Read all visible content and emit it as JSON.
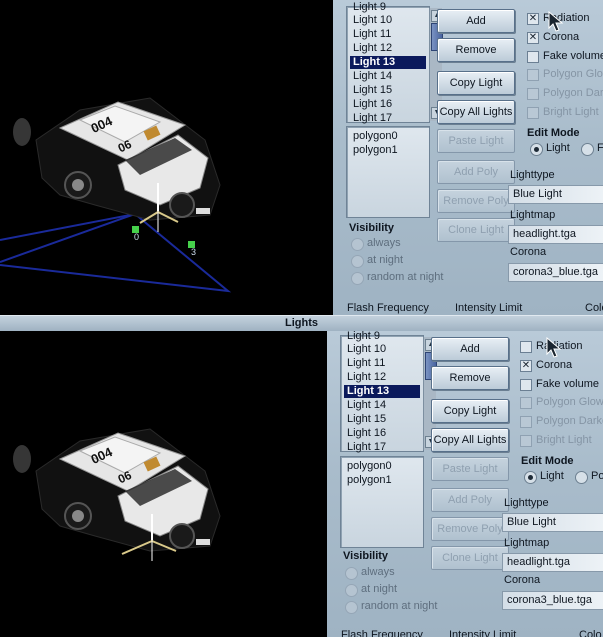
{
  "window_title": "Lights",
  "panels": [
    {
      "lights_list": [
        "Light 9",
        "Light 10",
        "Light 11",
        "Light 12",
        "Light 13",
        "Light 14",
        "Light 15",
        "Light 16",
        "Light 17"
      ],
      "selected_light": "Light 13",
      "polygons": [
        "polygon0",
        "polygon1"
      ],
      "buttons": {
        "add": "Add",
        "remove": "Remove",
        "copy_light": "Copy Light",
        "copy_all_lights": "Copy All Lights",
        "paste_light": "Paste Light",
        "add_poly": "Add Poly",
        "remove_poly": "Remove Poly",
        "clone_light": "Clone Light"
      },
      "options": {
        "radiation": {
          "label": "Radiation",
          "checked": true
        },
        "corona": {
          "label": "Corona",
          "checked": true
        },
        "fake_volume": {
          "label": "Fake volume",
          "checked": false
        },
        "polygon_glow": {
          "label": "Polygon Glow",
          "checked": false
        },
        "polygon_dark": {
          "label": "Polygon Dark",
          "checked": false
        },
        "bright_light": {
          "label": "Bright Light",
          "checked": false
        }
      },
      "edit_mode": {
        "title": "Edit Mode",
        "light": "Light",
        "other": "F"
      },
      "lighttype": {
        "label": "Lighttype",
        "value": "Blue Light"
      },
      "lightmap": {
        "label": "Lightmap",
        "value": "headlight.tga"
      },
      "corona_field": {
        "label": "Corona",
        "value": "corona3_blue.tga"
      },
      "visibility": {
        "title": "Visibility",
        "always": "always",
        "at_night": "at night",
        "random": "random at night",
        "selected": "at night"
      },
      "footer": {
        "flash_frequency": "Flash Frequency",
        "intensity_limit": "Intensity Limit",
        "color": "Colo"
      },
      "gizmo_points": [
        "0",
        "3"
      ]
    },
    {
      "lights_list": [
        "Light 9",
        "Light 10",
        "Light 11",
        "Light 12",
        "Light 13",
        "Light 14",
        "Light 15",
        "Light 16",
        "Light 17"
      ],
      "selected_light": "Light 13",
      "polygons": [
        "polygon0",
        "polygon1"
      ],
      "buttons": {
        "add": "Add",
        "remove": "Remove",
        "copy_light": "Copy Light",
        "copy_all_lights": "Copy All Lights",
        "paste_light": "Paste Light",
        "add_poly": "Add Poly",
        "remove_poly": "Remove Poly",
        "clone_light": "Clone Light"
      },
      "options": {
        "radiation": {
          "label": "Radiation",
          "checked": false
        },
        "corona": {
          "label": "Corona",
          "checked": true
        },
        "fake_volume": {
          "label": "Fake volume",
          "checked": false
        },
        "polygon_glow": {
          "label": "Polygon Glow",
          "checked": false
        },
        "polygon_dark": {
          "label": "Polygon Darke",
          "checked": false
        },
        "bright_light": {
          "label": "Bright Light",
          "checked": false
        }
      },
      "edit_mode": {
        "title": "Edit Mode",
        "light": "Light",
        "other": "Po"
      },
      "lighttype": {
        "label": "Lighttype",
        "value": "Blue Light"
      },
      "lightmap": {
        "label": "Lightmap",
        "value": "headlight.tga"
      },
      "corona_field": {
        "label": "Corona",
        "value": "corona3_blue.tga"
      },
      "visibility": {
        "title": "Visibility",
        "always": "always",
        "at_night": "at night",
        "random": "random at night",
        "selected": "at night"
      },
      "footer": {
        "flash_frequency": "Flash Frequency",
        "intensity_limit": "Intensity Limit",
        "color": "Colo"
      }
    }
  ],
  "colors": {
    "selection": "#0b1a5c",
    "viewport_bg": "#000000",
    "gizmo_line": "#1a2a9a",
    "gizmo_point": "#46d04b"
  }
}
